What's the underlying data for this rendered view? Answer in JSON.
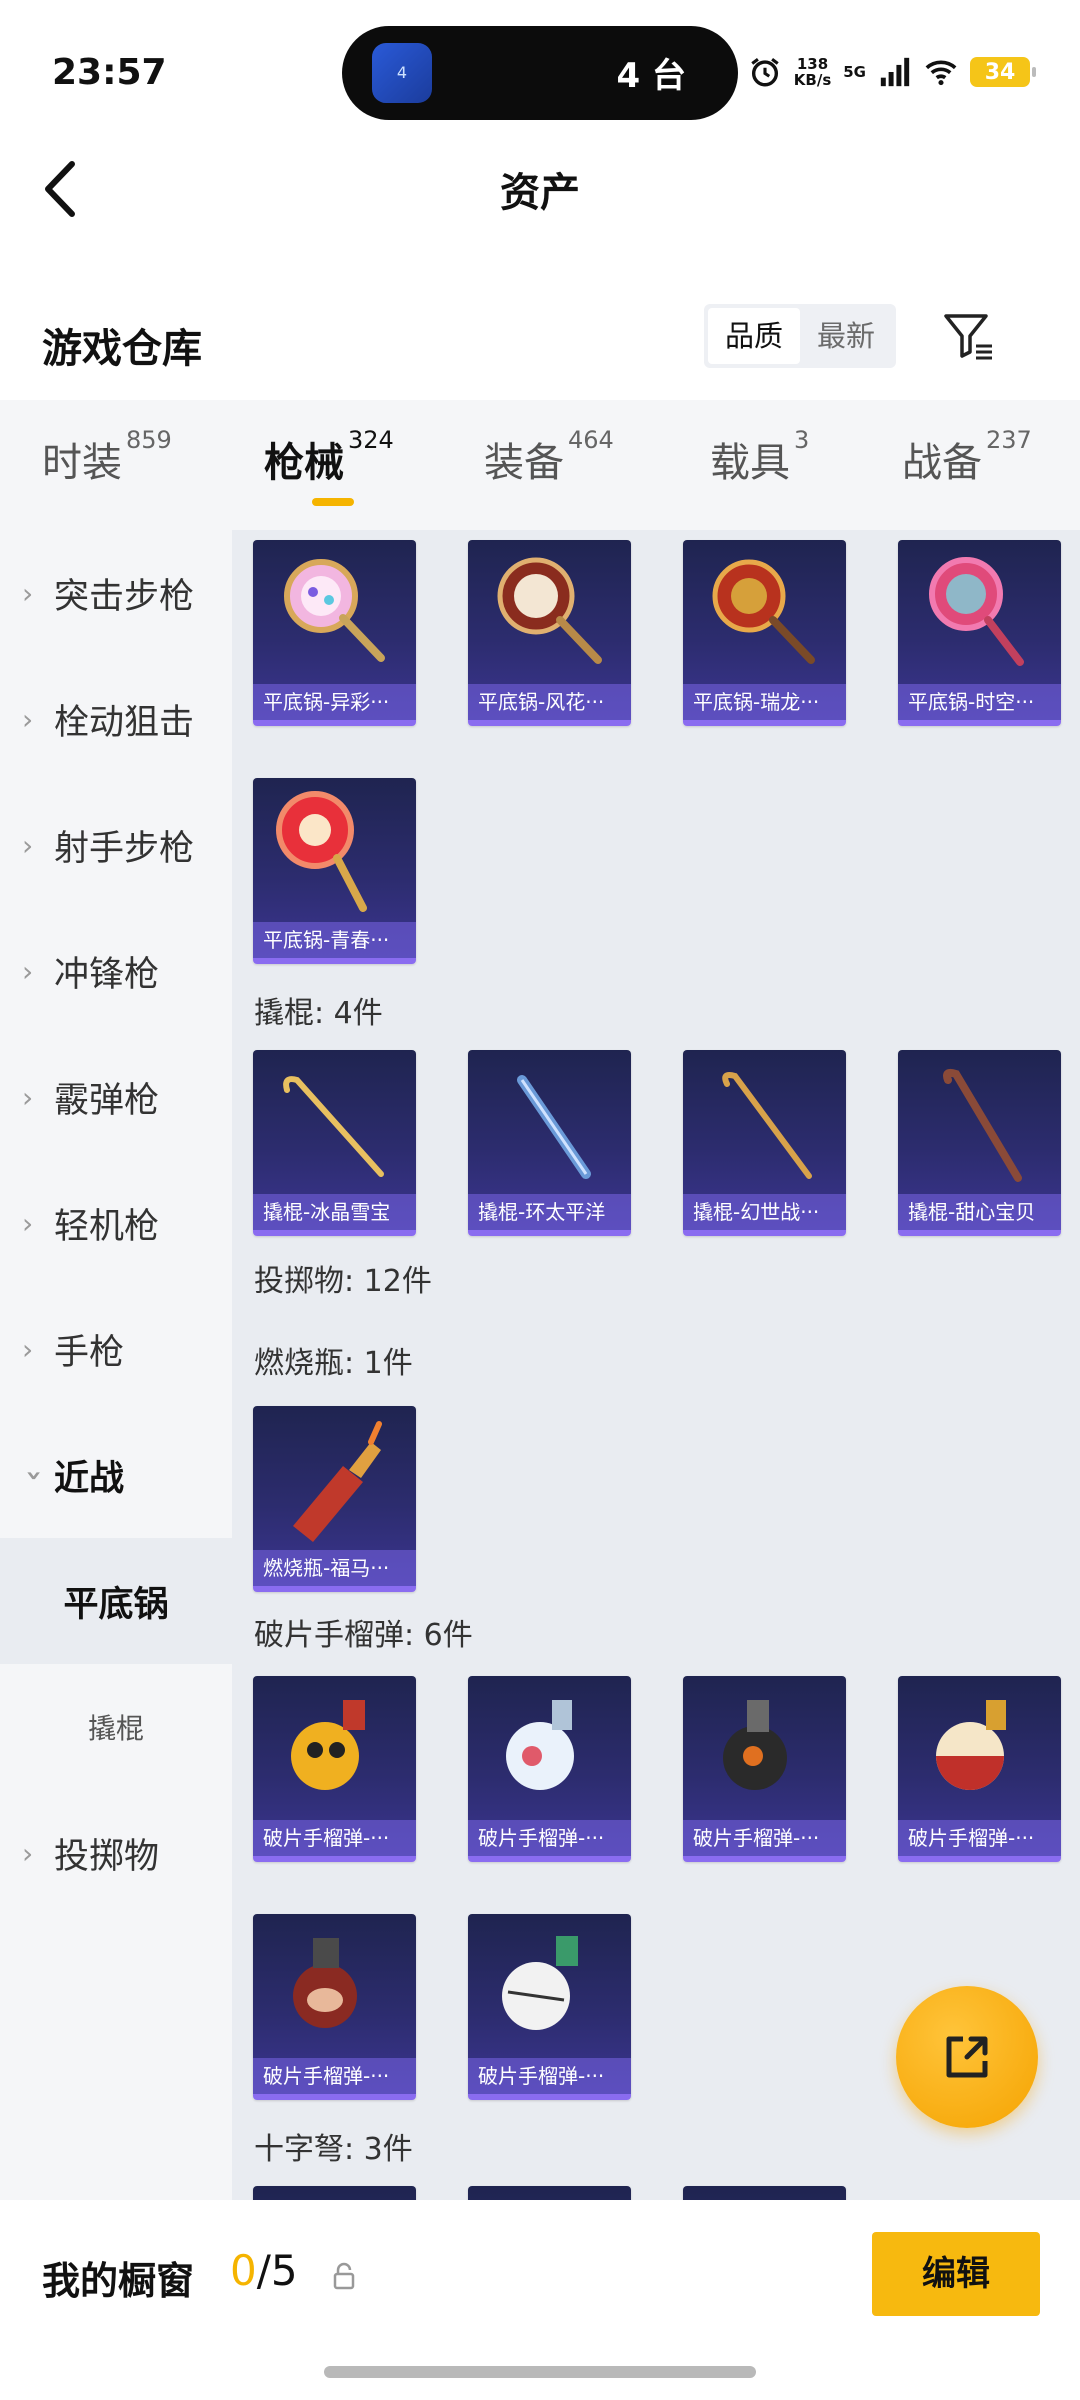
{
  "status_bar": {
    "time": "23:57",
    "island_app_icon": "4",
    "island_count": "4 台",
    "net_speed_value": "138",
    "net_speed_unit": "KB/s",
    "network": "5G",
    "battery": "34",
    "icons": [
      "alarm-icon",
      "signal-icon",
      "wifi-icon",
      "battery-icon"
    ]
  },
  "header": {
    "title": "资产",
    "back_icon": "chevron-left-icon"
  },
  "warehouse": {
    "title": "游戏仓库",
    "sort_options": [
      "品质",
      "最新"
    ],
    "active_sort": "品质",
    "filter_icon": "filter-icon"
  },
  "tabs": [
    {
      "label": "时装",
      "count": "859"
    },
    {
      "label": "枪械",
      "count": "324",
      "active": true
    },
    {
      "label": "装备",
      "count": "464"
    },
    {
      "label": "载具",
      "count": "3"
    },
    {
      "label": "战备",
      "count": "237"
    }
  ],
  "sidenav": {
    "items": [
      "突击步枪",
      "栓动狙击",
      "射手步枪",
      "冲锋枪",
      "霰弹枪",
      "轻机枪",
      "手枪"
    ],
    "expanded": "近战",
    "sub_items": [
      "平底锅",
      "撬棍"
    ],
    "last_item": "投掷物"
  },
  "content": {
    "pan_cards": [
      "平底锅-异彩···",
      "平底锅-风花···",
      "平底锅-瑞龙···",
      "平底锅-时空···",
      "平底锅-青春···"
    ],
    "crowbar_group": "撬棍: 4件",
    "crowbar_cards": [
      "撬棍-冰晶雪宝",
      "撬棍-环太平洋",
      "撬棍-幻世战···",
      "撬棍-甜心宝贝"
    ],
    "throwable_group": "投掷物: 12件",
    "molotov_group": "燃烧瓶: 1件",
    "molotov_cards": [
      "燃烧瓶-福马···"
    ],
    "frag_group": "破片手榴弹: 6件",
    "frag_cards": [
      "破片手榴弹-···",
      "破片手榴弹-···",
      "破片手榴弹-···",
      "破片手榴弹-···",
      "破片手榴弹-···",
      "破片手榴弹-···"
    ],
    "crossbow_group": "十字弩: 3件"
  },
  "fab": {
    "icon": "external-link-icon"
  },
  "bottom_bar": {
    "label": "我的橱窗",
    "used": "0",
    "total": "/5",
    "lock_icon": "lock-icon",
    "edit": "编辑"
  }
}
